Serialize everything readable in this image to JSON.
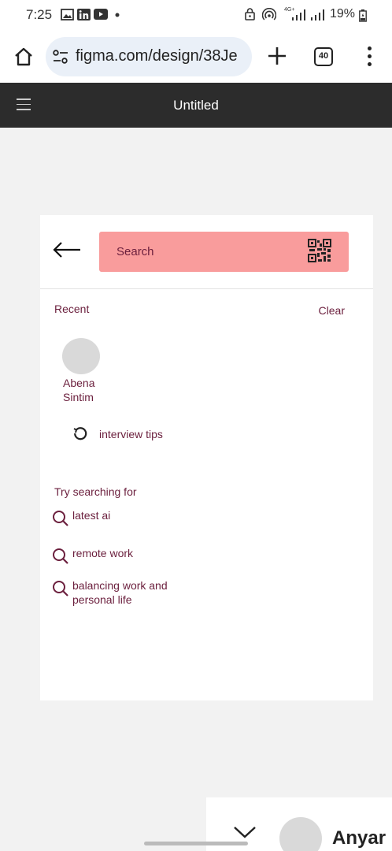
{
  "status_bar": {
    "time": "7:25",
    "network": "4G+",
    "battery": "19%",
    "left_icons": [
      "gallery-icon",
      "linkedin-icon",
      "youtube-icon",
      "dot-icon"
    ],
    "right_icons": [
      "lock-icon",
      "hotspot-icon",
      "signal-icon",
      "signal-icon",
      "battery-icon"
    ]
  },
  "browser": {
    "url": "figma.com/design/38Je",
    "tab_count": "40"
  },
  "figma": {
    "title": "Untitled"
  },
  "search_screen": {
    "search_placeholder": "Search",
    "recent_label": "Recent",
    "clear_label": "Clear",
    "recent_person": "Abena Sintim",
    "recent_query": "interview tips",
    "try_label": "Try searching for",
    "suggestions": [
      "latest ai",
      "remote work",
      "balancing work and personal life"
    ]
  },
  "peek_frame": {
    "name_partial": "Anyar"
  },
  "colors": {
    "accent_text": "#6b1f3d",
    "search_bg": "#f99c9c",
    "figma_header": "#2c2c2c",
    "canvas_bg": "#f2f2f2"
  }
}
